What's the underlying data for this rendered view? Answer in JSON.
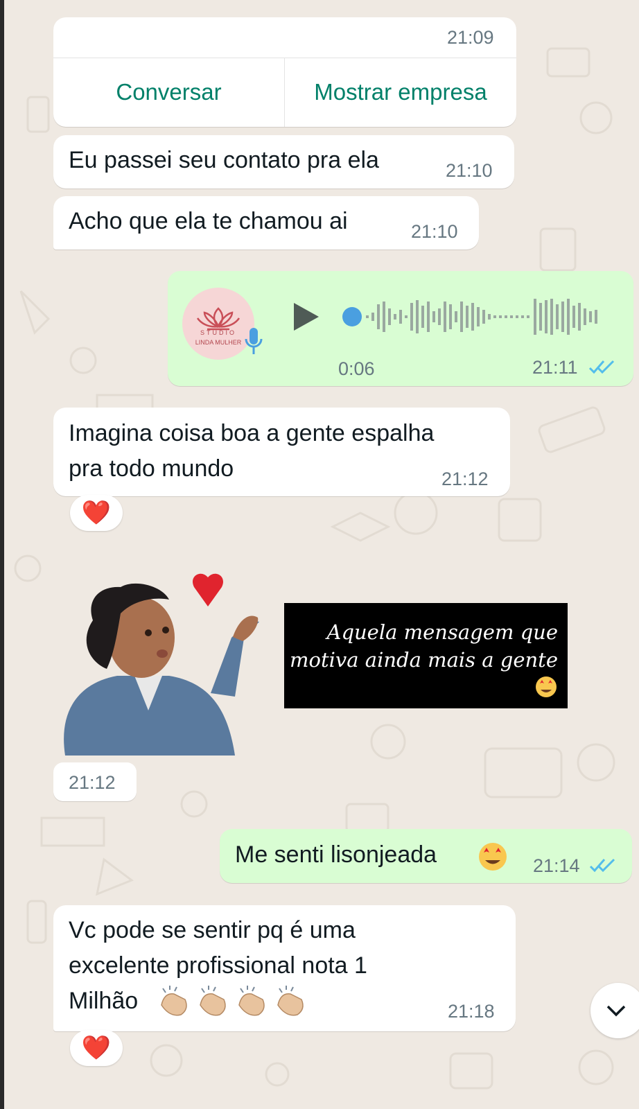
{
  "business_card": {
    "time": "21:09",
    "actions": [
      "Conversar",
      "Mostrar empresa"
    ]
  },
  "messages": [
    {
      "id": "m1",
      "direction": "in",
      "text": "Eu passei seu contato pra ela",
      "time": "21:10"
    },
    {
      "id": "m2",
      "direction": "in",
      "text": "Acho que ela te chamou ai",
      "time": "21:10"
    },
    {
      "id": "m3",
      "direction": "out",
      "type": "voice",
      "avatar_line1": "STUDIO",
      "avatar_line2": "LINDA MULHER",
      "duration": "0:06",
      "time": "21:11",
      "status": "read",
      "progress": 0.0
    },
    {
      "id": "m4",
      "direction": "in",
      "text_lines": [
        "Imagina coisa boa a gente espalha",
        "pra todo mundo"
      ],
      "time": "21:12",
      "reaction": "❤️"
    },
    {
      "id": "m5",
      "direction": "in",
      "type": "sticker",
      "quote_lines": [
        "Aquela mensagem que",
        "motiva ainda mais a gente"
      ],
      "time": "21:12"
    },
    {
      "id": "m6",
      "direction": "out",
      "text": "Me senti lisonjeada",
      "emoji": "star-struck",
      "time": "21:14",
      "status": "read"
    },
    {
      "id": "m7",
      "direction": "in",
      "text_lines": [
        "Vc pode se sentir pq é uma",
        "excelente profissional  nota 1",
        "Milhão"
      ],
      "emoji": "clapping-hands x4",
      "time": "21:18",
      "reaction": "❤️"
    }
  ],
  "colors": {
    "incoming_bubble": "#ffffff",
    "outgoing_bubble": "#d9fdd3",
    "accent_green": "#008069",
    "read_ticks": "#53bdeb",
    "background": "#efe9e2"
  }
}
